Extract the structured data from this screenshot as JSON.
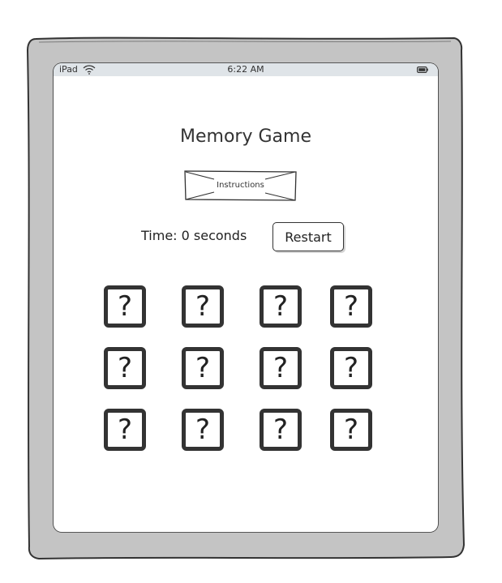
{
  "status_bar": {
    "device": "iPad",
    "time": "6:22 AM",
    "wifi_icon": "wifi-icon",
    "battery_icon": "battery-icon"
  },
  "game": {
    "title": "Memory Game",
    "instructions_label": "Instructions",
    "timer_text": "Time: 0 seconds",
    "restart_label": "Restart"
  },
  "cards": [
    {
      "label": "?"
    },
    {
      "label": "?"
    },
    {
      "label": "?"
    },
    {
      "label": "?"
    },
    {
      "label": "?"
    },
    {
      "label": "?"
    },
    {
      "label": "?"
    },
    {
      "label": "?"
    },
    {
      "label": "?"
    },
    {
      "label": "?"
    },
    {
      "label": "?"
    },
    {
      "label": "?"
    }
  ],
  "colors": {
    "frame": "#c4c4c4",
    "stroke": "#333333",
    "status_bar": "#dfe4e8"
  }
}
